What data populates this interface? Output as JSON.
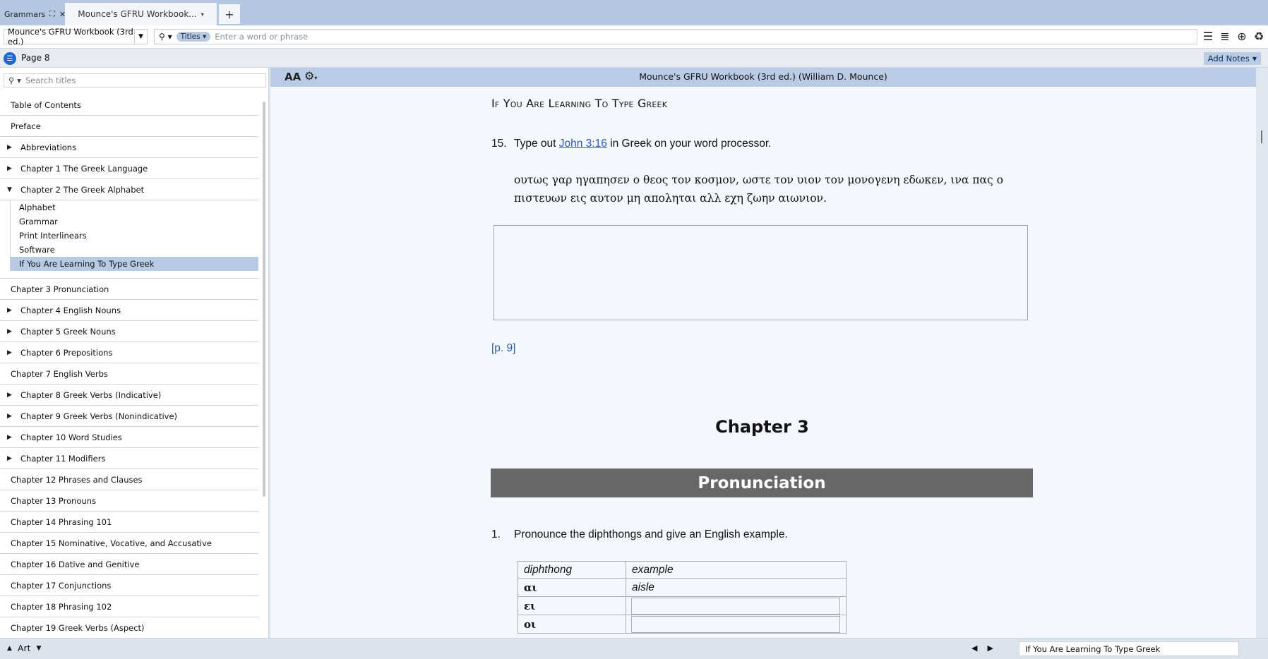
{
  "tabs": {
    "pinned_label": "Grammars",
    "doc_label": "Mounce's GFRU Workbook...",
    "add_label": "+"
  },
  "toolbar": {
    "resource": "Mounce's GFRU Workbook (3rd ed.)",
    "search_scope": "Titles",
    "search_placeholder": "Enter a word or phrase"
  },
  "location": {
    "page": "Page 8",
    "add_notes": "Add Notes"
  },
  "sidebar": {
    "search_placeholder": "Search titles",
    "items": [
      {
        "label": "Table of Contents",
        "arrow": ""
      },
      {
        "label": "Preface",
        "arrow": ""
      },
      {
        "label": "Abbreviations",
        "arrow": "▶"
      },
      {
        "label": "Chapter 1 The Greek Language",
        "arrow": "▶"
      },
      {
        "label": "Chapter 2 The Greek Alphabet",
        "arrow": "▼"
      }
    ],
    "subitems": [
      {
        "label": "Alphabet"
      },
      {
        "label": "Grammar"
      },
      {
        "label": "Print Interlinears"
      },
      {
        "label": "Software"
      },
      {
        "label": "If You Are Learning To Type Greek"
      }
    ],
    "items_after": [
      {
        "label": "Chapter 3 Pronunciation",
        "arrow": ""
      },
      {
        "label": "Chapter 4 English Nouns",
        "arrow": "▶"
      },
      {
        "label": "Chapter 5 Greek Nouns",
        "arrow": "▶"
      },
      {
        "label": "Chapter 6 Prepositions",
        "arrow": "▶"
      },
      {
        "label": "Chapter 7 English Verbs",
        "arrow": ""
      },
      {
        "label": "Chapter 8 Greek Verbs (Indicative)",
        "arrow": "▶"
      },
      {
        "label": "Chapter 9 Greek Verbs (Nonindicative)",
        "arrow": "▶"
      },
      {
        "label": "Chapter 10 Word Studies",
        "arrow": "▶"
      },
      {
        "label": "Chapter 11 Modifiers",
        "arrow": "▶"
      },
      {
        "label": "Chapter 12 Phrases and Clauses",
        "arrow": ""
      },
      {
        "label": "Chapter 13 Pronouns",
        "arrow": ""
      },
      {
        "label": "Chapter 14 Phrasing 101",
        "arrow": ""
      },
      {
        "label": "Chapter 15 Nominative, Vocative, and Accusative",
        "arrow": ""
      },
      {
        "label": "Chapter 16 Dative and Genitive",
        "arrow": ""
      },
      {
        "label": "Chapter 17 Conjunctions",
        "arrow": ""
      },
      {
        "label": "Chapter 18 Phrasing 102",
        "arrow": ""
      },
      {
        "label": "Chapter 19 Greek Verbs (Aspect)",
        "arrow": ""
      }
    ]
  },
  "reader": {
    "title": "Mounce's GFRU Workbook (3rd ed.) (William D. Mounce)",
    "font_icon": "AA",
    "section_heading": "If You Are Learning To Type Greek",
    "item15_num": "15.",
    "item15_before": "Type out ",
    "item15_link": "John 3:16",
    "item15_after": " in Greek on your word processor.",
    "greek_line1": "ουτως γαρ ηγαπησεν ο θεος τον κοσμον, ωστε τον υιον τον μονογενη εδωκεν, ινα πας ο",
    "greek_line2": "πιστευων εις αυτον μη αποληται αλλ εχη ζωην αιωνιον.",
    "page_ref": "[p. 9]",
    "chapter_num": "Chapter 3",
    "chapter_title": "Pronunciation",
    "item1_num": "1.",
    "item1_text": "Pronounce the diphthongs and give an English example.",
    "table": {
      "headers": [
        "diphthong",
        "example"
      ],
      "rows": [
        {
          "diphthong": "αι",
          "example": "aisle"
        },
        {
          "diphthong": "ει",
          "example": ""
        },
        {
          "diphthong": "οι",
          "example": ""
        }
      ]
    }
  },
  "bottom": {
    "art_label": "Art",
    "location": "If You Are Learning To Type Greek"
  }
}
